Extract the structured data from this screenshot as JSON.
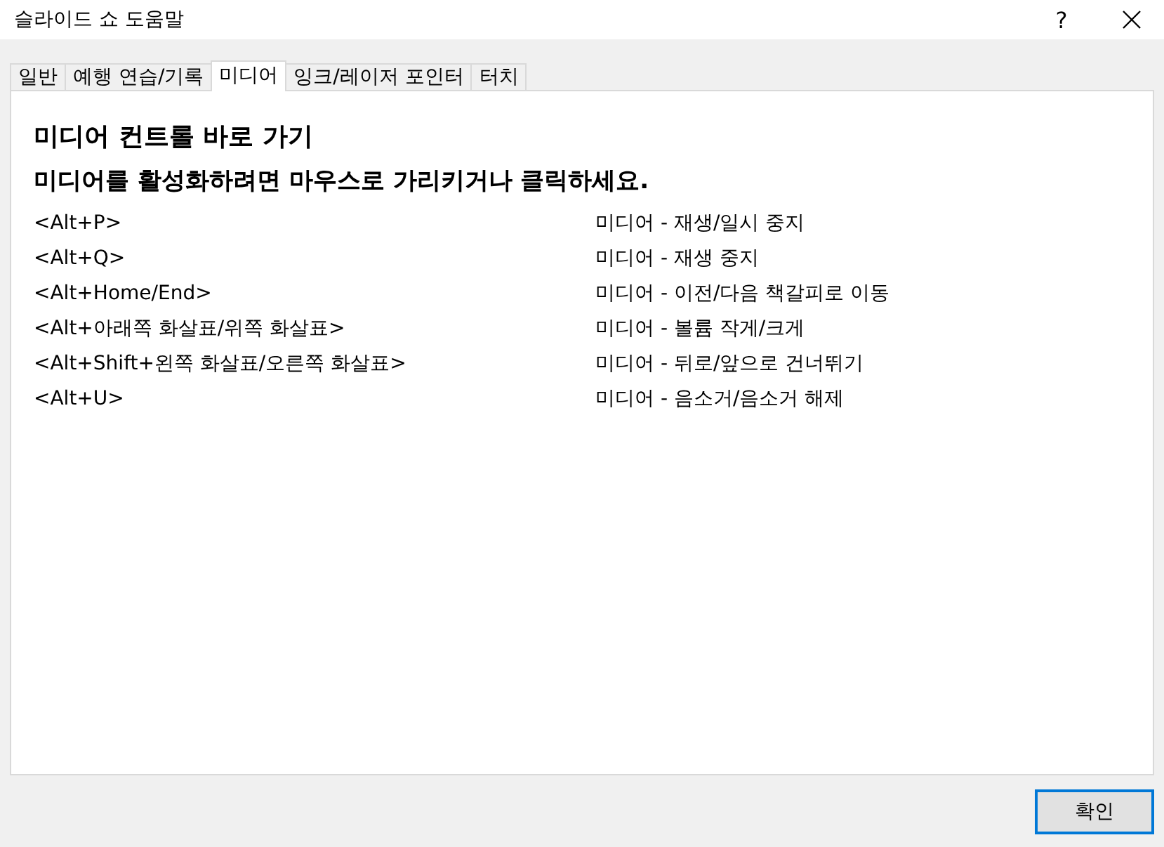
{
  "window": {
    "title": "슬라이드 쇼 도움말",
    "help": "?"
  },
  "tabs": [
    {
      "label": "일반",
      "selected": false
    },
    {
      "label": "예행 연습/기록",
      "selected": false
    },
    {
      "label": "미디어",
      "selected": true
    },
    {
      "label": "잉크/레이저 포인터",
      "selected": false
    },
    {
      "label": "터치",
      "selected": false
    }
  ],
  "heading": "미디어 컨트롤 바로 가기",
  "subheading": "미디어를 활성화하려면 마우스로 가리키거나 클릭하세요.",
  "shortcuts": [
    {
      "keys": "<Alt+P>",
      "action": "미디어 - 재생/일시 중지"
    },
    {
      "keys": "<Alt+Q>",
      "action": "미디어 - 재생 중지"
    },
    {
      "keys": "<Alt+Home/End>",
      "action": "미디어 - 이전/다음 책갈피로 이동"
    },
    {
      "keys": "<Alt+아래쪽 화살표/위쪽 화살표>",
      "action": "미디어 - 볼륨 작게/크게"
    },
    {
      "keys": "<Alt+Shift+왼쪽 화살표/오른쪽 화살표>",
      "action": "미디어 - 뒤로/앞으로 건너뛰기"
    },
    {
      "keys": "<Alt+U>",
      "action": "미디어 - 음소거/음소거 해제"
    }
  ],
  "buttons": [
    "확인"
  ]
}
